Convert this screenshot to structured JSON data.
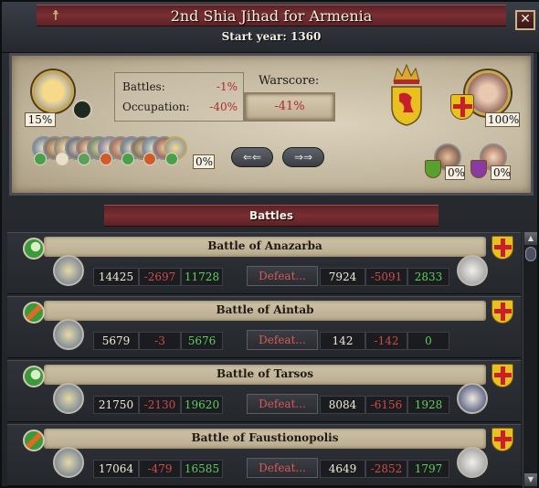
{
  "window": {
    "title": "2nd Shia Jihad for Armenia",
    "start_year": "Start year: 1360",
    "close_label": "✕",
    "religion_icon": "☨"
  },
  "summary": {
    "attacker_pct": "15%",
    "defender_pct": "100%",
    "battles_label": "Battles:",
    "battles_value": "-1%",
    "occupation_label": "Occupation:",
    "occupation_value": "-40%",
    "warscore_label": "Warscore:",
    "warscore_value": "-41%",
    "attacker_allies_pct": "0%",
    "defender_ally_1_pct": "0%",
    "defender_ally_2_pct": "0%",
    "prev_label": "⇐⇐",
    "next_label": "⇒⇒",
    "colors": {
      "loss": "#b02a2a",
      "gain": "#5fcf5f"
    }
  },
  "battles_header": "Battles",
  "battles": [
    {
      "name": "Battle of Anazarba",
      "att_start": "14425",
      "att_loss": "-2697",
      "att_end": "11728",
      "result": "Defeat...",
      "def_start": "7924",
      "def_loss": "-5091",
      "def_end": "2833",
      "icon": "crescent-icon"
    },
    {
      "name": "Battle of Aintab",
      "att_start": "5679",
      "att_loss": "-3",
      "att_end": "5676",
      "result": "Defeat...",
      "def_start": "142",
      "def_loss": "-142",
      "def_end": "0",
      "icon": "sword-icon"
    },
    {
      "name": "Battle of Tarsos",
      "att_start": "21750",
      "att_loss": "-2130",
      "att_end": "19620",
      "result": "Defeat...",
      "def_start": "8084",
      "def_loss": "-6156",
      "def_end": "1928",
      "icon": "crescent-icon"
    },
    {
      "name": "Battle of Faustionopolis",
      "att_start": "17064",
      "att_loss": "-479",
      "att_end": "16585",
      "result": "Defeat...",
      "def_start": "4649",
      "def_loss": "-2852",
      "def_end": "1797",
      "icon": "sword-icon"
    }
  ],
  "scroll": {
    "up": "▲",
    "down": "▼"
  }
}
